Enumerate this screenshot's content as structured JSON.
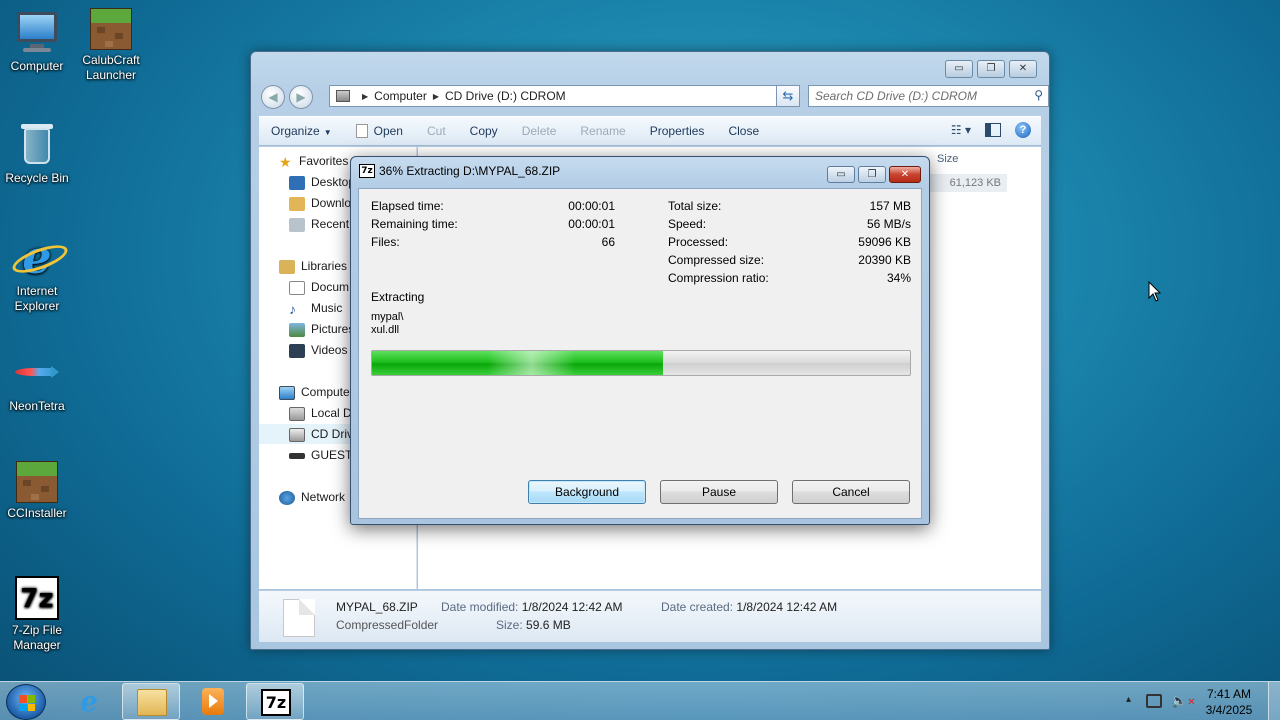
{
  "desktop": {
    "icons": [
      {
        "label": "Computer"
      },
      {
        "label": "CalubCraft Launcher"
      },
      {
        "label": "Recycle Bin"
      },
      {
        "label": "Internet Explorer"
      },
      {
        "label": "NeonTetra"
      },
      {
        "label": "CCInstaller"
      },
      {
        "label": "7-Zip File Manager"
      }
    ]
  },
  "explorer": {
    "window_controls": {
      "minimize": "▭",
      "maximize": "❐",
      "close": "✕"
    },
    "breadcrumb": [
      "Computer",
      "CD Drive (D:) CDROM"
    ],
    "search_placeholder": "Search CD Drive (D:) CDROM",
    "toolbar": {
      "organize": "Organize",
      "open": "Open",
      "cut": "Cut",
      "copy": "Copy",
      "delete": "Delete",
      "rename": "Rename",
      "properties": "Properties",
      "close": "Close"
    },
    "nav": {
      "favorites": "Favorites",
      "desktop": "Desktop",
      "downloads": "Downlo",
      "recent": "Recent",
      "libraries": "Libraries",
      "documents": "Docum",
      "music": "Music",
      "pictures": "Pictures",
      "videos": "Videos",
      "computer": "Compute",
      "local_disk": "Local Di",
      "cd_drive": "CD Drive",
      "guest": "GUEST7",
      "network": "Network"
    },
    "columns": {
      "size": "Size"
    },
    "row": {
      "size": "61,123 KB"
    },
    "details": {
      "file_name": "MYPAL_68.ZIP",
      "file_type": "CompressedFolder",
      "date_modified_label": "Date modified:",
      "date_modified": "1/8/2024 12:42 AM",
      "date_created_label": "Date created:",
      "date_created": "1/8/2024 12:42 AM",
      "size_label": "Size:",
      "size": "59.6 MB"
    }
  },
  "dialog": {
    "app_icon": "7z",
    "title": "36% Extracting D:\\MYPAL_68.ZIP",
    "progress_fraction": 0.54,
    "stats_left": [
      {
        "label": "Elapsed time:",
        "value": "00:00:01"
      },
      {
        "label": "Remaining time:",
        "value": "00:00:01"
      },
      {
        "label": "Files:",
        "value": "66"
      }
    ],
    "stats_right": [
      {
        "label": "Total size:",
        "value": "157 MB"
      },
      {
        "label": "Speed:",
        "value": "56 MB/s"
      },
      {
        "label": "Processed:",
        "value": "59096 KB"
      },
      {
        "label": "Compressed size:",
        "value": "20390 KB"
      },
      {
        "label": "Compression ratio:",
        "value": "34%"
      }
    ],
    "status": "Extracting",
    "path_line1": "mypal\\",
    "path_line2": "xul.dll",
    "buttons": {
      "background": "Background",
      "pause": "Pause",
      "cancel": "Cancel"
    }
  },
  "taskbar": {
    "time": "7:41 AM",
    "date": "3/4/2025",
    "tray_arrow": "▴",
    "pinned": [
      {
        "name": "internet-explorer",
        "icon": "ie-icon"
      },
      {
        "name": "windows-explorer",
        "icon": "folder-icon"
      },
      {
        "name": "media-player",
        "icon": "media-icon"
      },
      {
        "name": "7-zip",
        "icon": "7z-icon"
      }
    ],
    "seven_zip_label": "7z"
  },
  "colors": {
    "progress_green": "#1fbf1f",
    "close_red": "#c9432f",
    "desktop_blue": "#1c86ad"
  }
}
